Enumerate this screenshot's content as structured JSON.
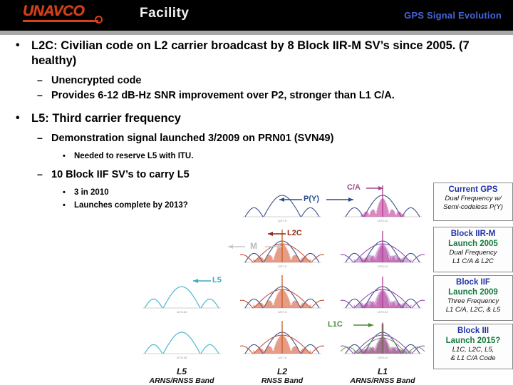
{
  "header": {
    "logo_text": "UNAVCO",
    "logo_name": "unavco-logo",
    "facility_label": "Facility",
    "deck_title": "GPS Signal Evolution",
    "bg_color": "#000000",
    "logo_color": "#d3401a",
    "title_color": "#4763d8",
    "rule_color": "#a8a8a8"
  },
  "bullets": [
    {
      "level": 1,
      "marker": "•",
      "text": "L2C:  Civilian code on L2 carrier broadcast by 8 Block IIR-M SV’s since 2005. (7 healthy)"
    },
    {
      "level": 2,
      "marker": "–",
      "text": "Unencrypted code"
    },
    {
      "level": 2,
      "marker": "–",
      "text": "Provides 6-12 dB-Hz SNR improvement over P2, stronger than L1 C/A."
    },
    {
      "level": 1,
      "marker": "•",
      "text": "L5:  Third carrier frequency"
    },
    {
      "level": 2,
      "marker": "–",
      "text": "Demonstration signal launched 3/2009 on PRN01 (SVN49)"
    },
    {
      "level": 3,
      "marker": "•",
      "text": "Needed to reserve L5 with ITU."
    },
    {
      "level": 2,
      "marker": "–",
      "text": "10 Block IIF SV’s to carry L5"
    },
    {
      "level": 3,
      "marker": "•",
      "text": "3 in 2010"
    },
    {
      "level": 3,
      "marker": "•",
      "text": "Launches complete by 2013?"
    }
  ],
  "figure": {
    "columns": [
      {
        "band": "L5",
        "caption": "ARNS/RNSS Band",
        "center_freq": "1176.45"
      },
      {
        "band": "L2",
        "caption": "RNSS Band",
        "center_freq": "1227.6"
      },
      {
        "band": "L1",
        "caption": "ARNS/RNSS Band",
        "center_freq": "1575.42"
      }
    ],
    "annotations": [
      {
        "label": "P(Y)",
        "color": "#2b4a8b",
        "name": "py-annotation"
      },
      {
        "label": "C/A",
        "color": "#9c4a8c",
        "name": "ca-annotation"
      },
      {
        "label": "L2C",
        "color": "#8e2a18",
        "name": "l2c-annotation"
      },
      {
        "label": "M",
        "color": "#b9b9b9",
        "name": "m-code-annotation"
      },
      {
        "label": "L5",
        "color": "#3fa8bd",
        "name": "l5-annotation"
      },
      {
        "label": "L1C",
        "color": "#4c8b3a",
        "name": "l1c-annotation"
      }
    ],
    "rows": [
      {
        "row": 1,
        "l5": false,
        "l2": "py",
        "l1": "ca"
      },
      {
        "row": 2,
        "l5": false,
        "l2": "l2c_m",
        "l1": "ca_m"
      },
      {
        "row": 3,
        "l5": true,
        "l2": "l2c_m",
        "l1": "ca_m"
      },
      {
        "row": 4,
        "l5": true,
        "l2": "l2c_m",
        "l1": "ca_m_l1c"
      }
    ]
  },
  "legend_boxes": [
    {
      "title": "Current GPS",
      "launch": "",
      "desc_line1": "Dual Frequency w/",
      "desc_line2": "Semi-codeless P(Y)"
    },
    {
      "title": "Block IIR-M",
      "launch": "Launch 2005",
      "desc_line1": "Dual Frequency",
      "desc_line2": "L1 C/A & L2C"
    },
    {
      "title": "Block IIF",
      "launch": "Launch 2009",
      "desc_line1": "Three Frequency",
      "desc_line2": "L1 C/A, L2C, & L5"
    },
    {
      "title": "Block III",
      "launch": "Launch 2015?",
      "desc_line1": "L1C, L2C, L5,",
      "desc_line2": "& L1 C/A Code"
    }
  ]
}
